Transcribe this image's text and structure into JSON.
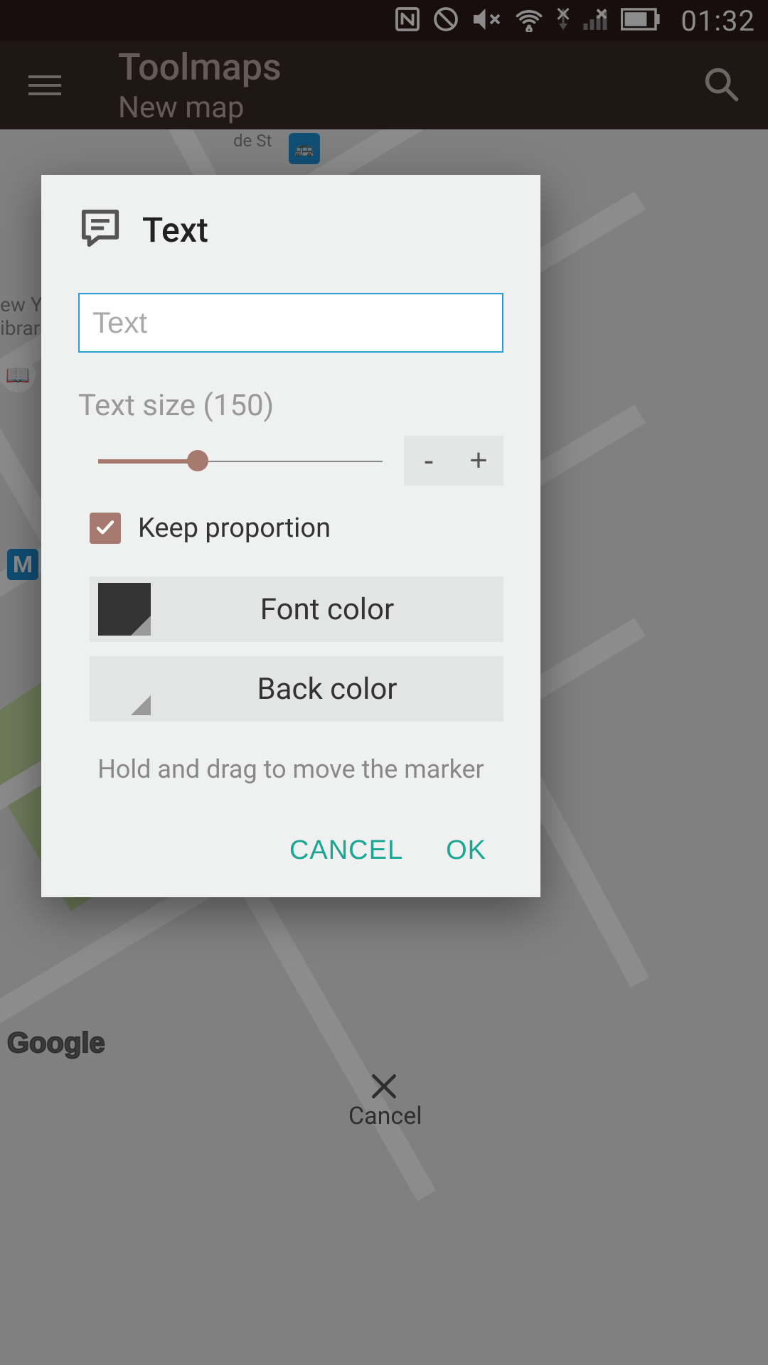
{
  "status_bar": {
    "time": "01:32"
  },
  "app_bar": {
    "title": "Toolmaps",
    "subtitle": "New map"
  },
  "map": {
    "street_label": "de St",
    "poi_text": "ew Y\nibrar",
    "google_logo": "Google",
    "bottom_cancel": "Cancel"
  },
  "dialog": {
    "title": "Text",
    "input_placeholder": "Text",
    "size_label_prefix": "Text size (",
    "size_value": "150",
    "size_label_suffix": ")",
    "minus": "-",
    "plus": "+",
    "keep_proportion": "Keep proportion",
    "font_color": "Font color",
    "back_color": "Back color",
    "hint": "Hold and drag to move the marker",
    "cancel": "CANCEL",
    "ok": "OK",
    "colors": {
      "font": "#333333",
      "back": "transparent",
      "accent": "#1aa693"
    }
  }
}
